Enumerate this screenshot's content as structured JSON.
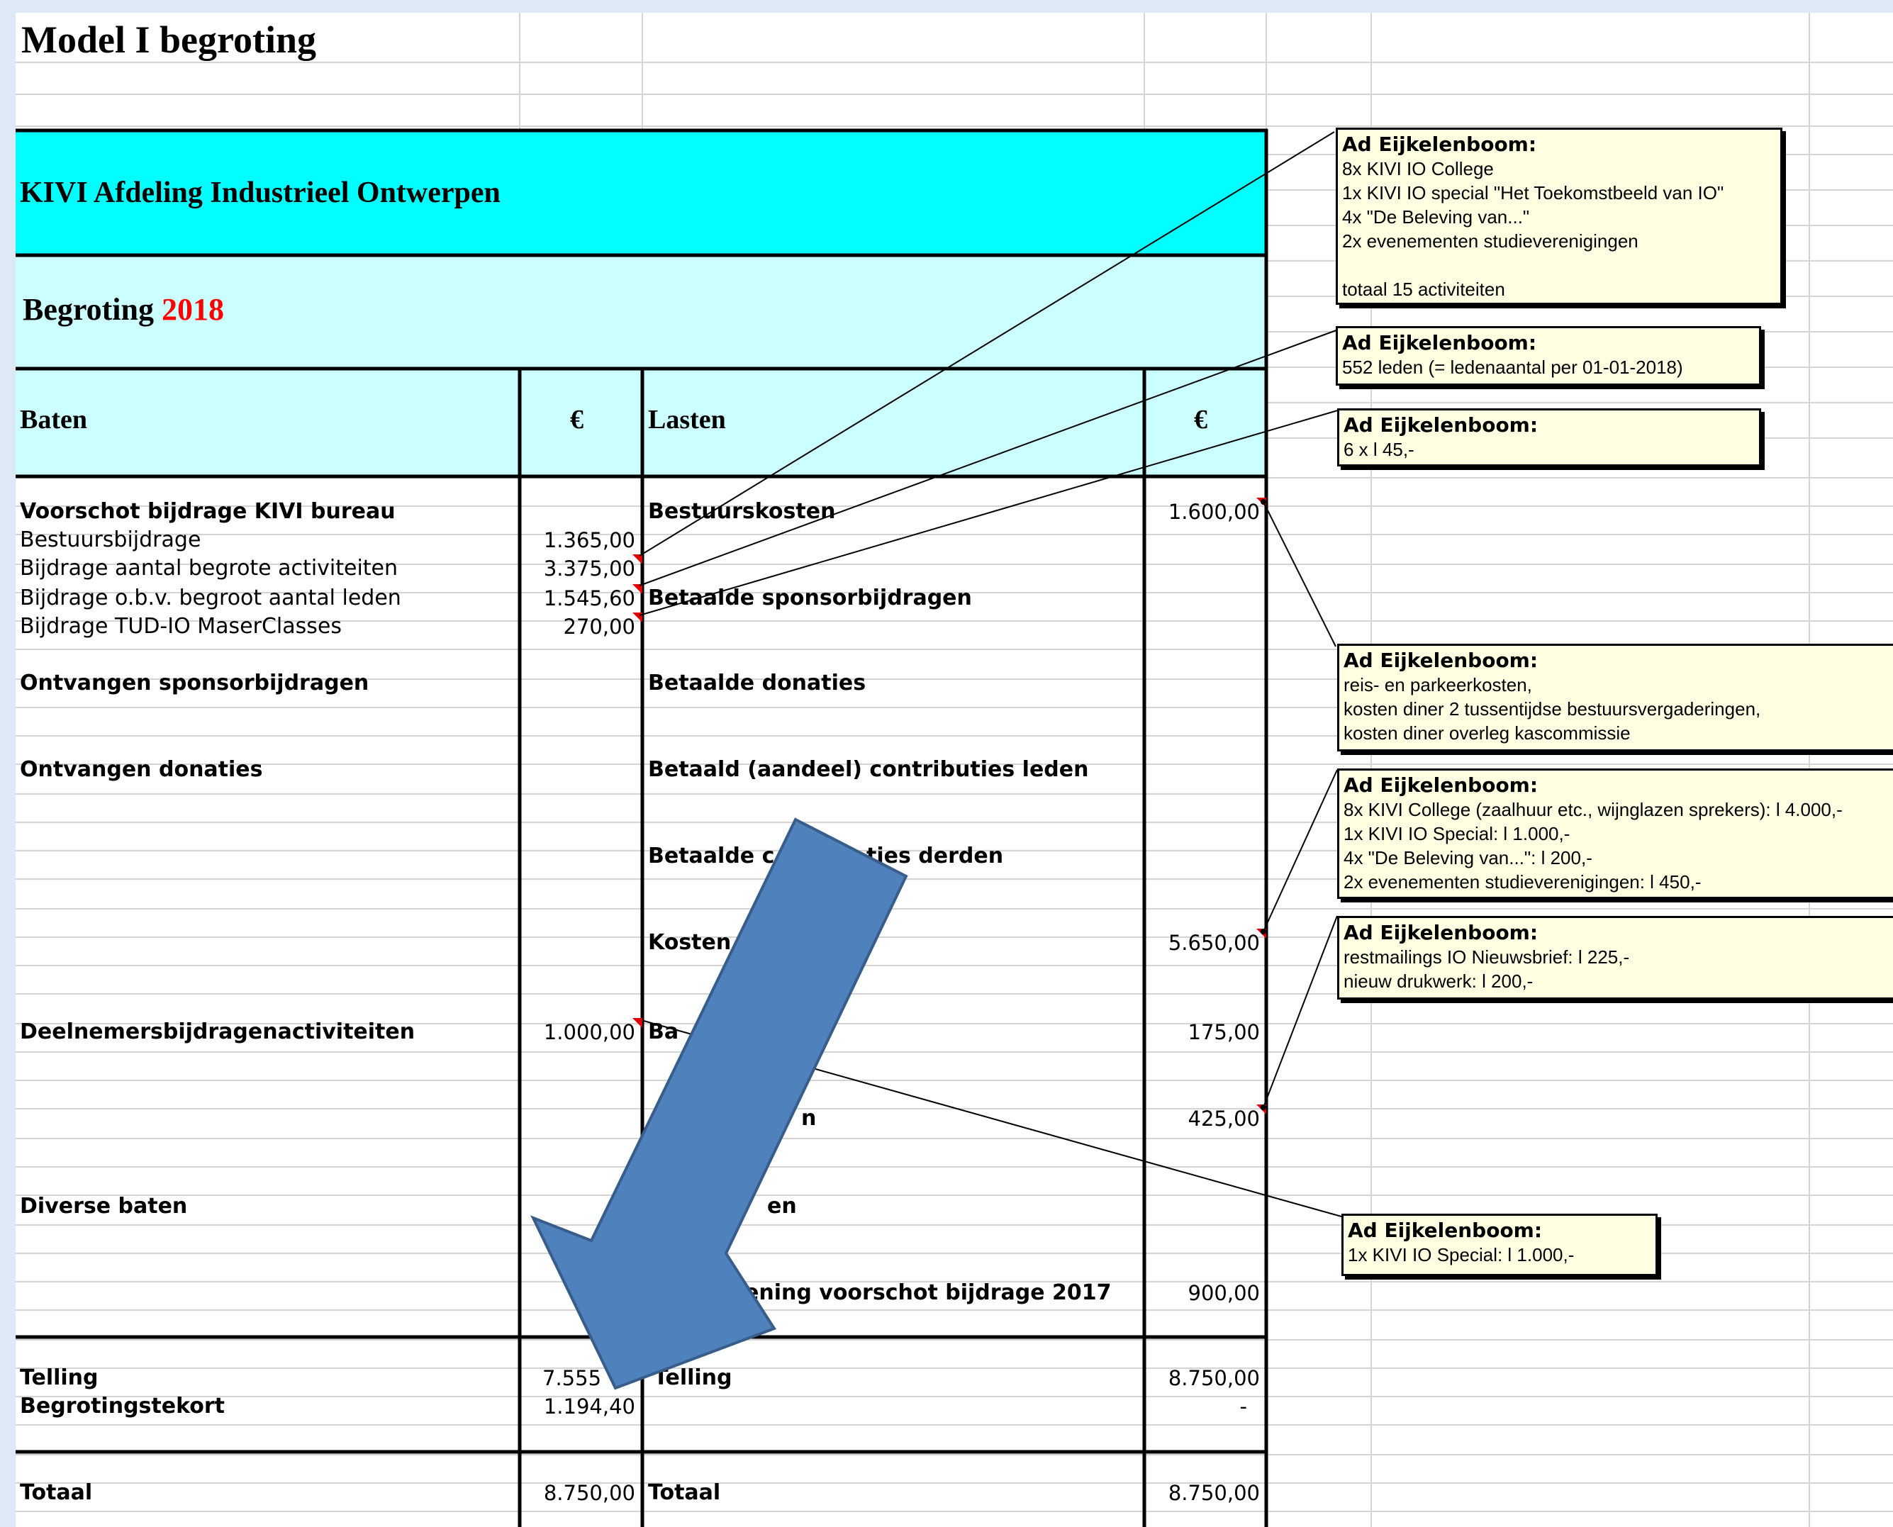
{
  "sheet": {
    "title": "Model I begroting",
    "org": "KIVI Afdeling Industrieel Ontwerpen",
    "begroting_label": "Begroting",
    "begroting_year": "2018",
    "baten_header": "Baten",
    "euro1": "€",
    "lasten_header": "Lasten",
    "euro2": "€"
  },
  "baten": {
    "voorschot": "Voorschot bijdrage KIVI bureau",
    "bestuursbijdrage": "Bestuursbijdrage",
    "bestuursbijdrage_val": "1.365,00",
    "activiteiten": "Bijdrage aantal begrote activiteiten",
    "activiteiten_val": "3.375,00",
    "leden": "Bijdrage o.b.v. begroot aantal leden",
    "leden_val": "1.545,60",
    "tud": "Bijdrage TUD-IO MaserClasses",
    "tud_val": "270,00",
    "sponsor": "Ontvangen sponsorbijdragen",
    "donaties": "Ontvangen donaties",
    "deelnemers": "Deelnemersbijdragenactiviteiten",
    "deelnemers_val": "1.000,00",
    "diverse": "Diverse baten",
    "diverse_val": "-",
    "telling": "Telling",
    "telling_val": "7.555",
    "tekort": "Begrotingstekort",
    "tekort_val": "1.194,40",
    "totaal": "Totaal",
    "totaal_val": "8.750,00"
  },
  "lasten": {
    "bestuurskosten": "Bestuurskosten",
    "bestuurskosten_val": "1.600,00",
    "sponsor": "Betaalde sponsorbijdragen",
    "donaties": "Betaalde donaties",
    "contributies": "Betaald (aandeel) contributies leden",
    "derden_a": "Betaalde c",
    "derden_b": "ties derden",
    "kosten": "Kosten",
    "kosten_val": "5.650,00",
    "ban": "Ba",
    "ban_val": "175,00",
    "row9": "n",
    "row9_val": "425,00",
    "row10": "en",
    "verrekening": "ening voorschot bijdrage 2017",
    "verrekening_val": "900,00",
    "telling": "Telling",
    "telling_val": "8.750,00",
    "tekort_val": "-",
    "totaal": "Totaal",
    "totaal_val": "8.750,00"
  },
  "comments": [
    {
      "author": "Ad Eijkelenboom:",
      "lines": [
        "8x KIVI IO College",
        "1x KIVI IO special \"Het Toekomstbeeld van IO\"",
        "4x \"De Beleving van...\"",
        "2x evenementen studieverenigingen",
        "",
        "totaal 15 activiteiten"
      ]
    },
    {
      "author": "Ad Eijkelenboom:",
      "lines": [
        "552 leden (= ledenaantal per 01-01-2018)"
      ]
    },
    {
      "author": "Ad Eijkelenboom:",
      "lines": [
        "6 x l 45,-"
      ]
    },
    {
      "author": "Ad Eijkelenboom:",
      "lines": [
        "reis- en parkeerkosten,",
        "kosten diner 2 tussentijdse bestuursvergaderingen,",
        "kosten diner overleg kascommissie"
      ]
    },
    {
      "author": "Ad Eijkelenboom:",
      "lines": [
        "8x KIVI College (zaalhuur etc., wijnglazen sprekers): l 4.000,-",
        "1x KIVI IO Special: l 1.000,-",
        "4x \"De Beleving van...\": l 200,-",
        "2x evenementen studieverenigingen: l 450,-"
      ]
    },
    {
      "author": "Ad Eijkelenboom:",
      "lines": [
        "restmailings IO Nieuwsbrief: l 225,-",
        "nieuw drukwerk: l 200,-"
      ]
    },
    {
      "author": "Ad Eijkelenboom:",
      "lines": [
        "1x KIVI IO Special: l 1.000,-"
      ]
    }
  ],
  "colors": {
    "title_band": "#00ffff",
    "header_band": "#ccffff",
    "year_red": "#ff0000",
    "comment_bg": "#ffffe1",
    "arrow_fill": "#4f81bd",
    "arrow_stroke": "#385d8a"
  }
}
